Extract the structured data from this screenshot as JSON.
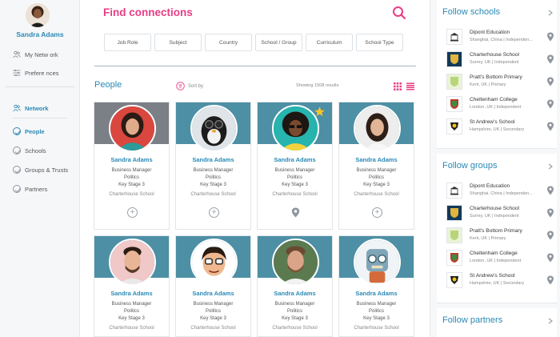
{
  "user": {
    "name": "Sandra Adams"
  },
  "sidebar": {
    "top_items": [
      {
        "label": "My Netw ork",
        "icon": "people-icon"
      },
      {
        "label": "Prefere nces",
        "icon": "sliders-icon"
      }
    ],
    "section": {
      "label": "Network",
      "icon": "network-icon"
    },
    "items": [
      {
        "label": "People",
        "active": true
      },
      {
        "label": "Schools",
        "active": false
      },
      {
        "label": "Groups & Trusts",
        "active": false
      },
      {
        "label": "Partners",
        "active": false
      }
    ]
  },
  "main": {
    "title": "Find connections",
    "filters": [
      "Job Role",
      "Subject",
      "Country",
      "School / Group",
      "Curriculum",
      "School Type"
    ],
    "section_title": "People",
    "sort_label": "Sort by",
    "results_text": "Showing 1508 results",
    "cards": [
      {
        "name": "Sandra Adams",
        "role": "Business Manager",
        "subject": "Politics",
        "stage": "Key Stage 3",
        "school": "Charterhouse School",
        "action": "add"
      },
      {
        "name": "Sandra Adams",
        "role": "Business Manager",
        "subject": "Politics",
        "stage": "Key Stage 3",
        "school": "Charterhouse School",
        "action": "add"
      },
      {
        "name": "Sandra Adams",
        "role": "Business Manager",
        "subject": "Politics",
        "stage": "Key Stage 3",
        "school": "Charterhouse School",
        "action": "pin"
      },
      {
        "name": "Sandra Adams",
        "role": "Business Manager",
        "subject": "Politics",
        "stage": "Key Stage 3",
        "school": "Charterhouse School",
        "action": "add"
      },
      {
        "name": "Sandra Adams",
        "role": "Business Manager",
        "subject": "Politics",
        "stage": "Key Stage 3",
        "school": "Charterhouse School",
        "action": "add"
      },
      {
        "name": "Sandra Adams",
        "role": "Business Manager",
        "subject": "Politics",
        "stage": "Key Stage 3",
        "school": "Charterhouse School",
        "action": "add"
      },
      {
        "name": "Sandra Adams",
        "role": "Business Manager",
        "subject": "Politics",
        "stage": "Key Stage 3",
        "school": "Charterhouse School",
        "action": "add"
      },
      {
        "name": "Sandra Adams",
        "role": "Business Manager",
        "subject": "Politics",
        "stage": "Key Stage 3",
        "school": "Charterhouse School",
        "action": "add"
      }
    ]
  },
  "right": {
    "schools": {
      "title": "Follow schools",
      "items": [
        {
          "name": "Dipont Education",
          "sub": "Shanghai, China | Independen..."
        },
        {
          "name": "Charterhouse School",
          "sub": "Surrey, UK | Independent"
        },
        {
          "name": "Pratt's Bottom Primary",
          "sub": "Kent, UK | Primary"
        },
        {
          "name": "Cheltenham College",
          "sub": "London, UK | Independent"
        },
        {
          "name": "St Andrew's School",
          "sub": "Hampshire, UK | Secondary"
        }
      ]
    },
    "groups": {
      "title": "Follow groups",
      "items": [
        {
          "name": "Dipont Education",
          "sub": "Shanghai, China | Independen..."
        },
        {
          "name": "Charterhouse School",
          "sub": "Surrey, UK | Independent"
        },
        {
          "name": "Pratt's Bottom Primary",
          "sub": "Kent, UK | Primary"
        },
        {
          "name": "Cheltenham College",
          "sub": "London, UK | Independent"
        },
        {
          "name": "St Andrew's School",
          "sub": "Hampshire, UK | Secondary"
        }
      ]
    },
    "partners": {
      "title": "Follow partners"
    }
  },
  "colors": {
    "accent_pink": "#e93d86",
    "accent_blue": "#2a89b5",
    "banner_teal": "#4d8fa5"
  }
}
